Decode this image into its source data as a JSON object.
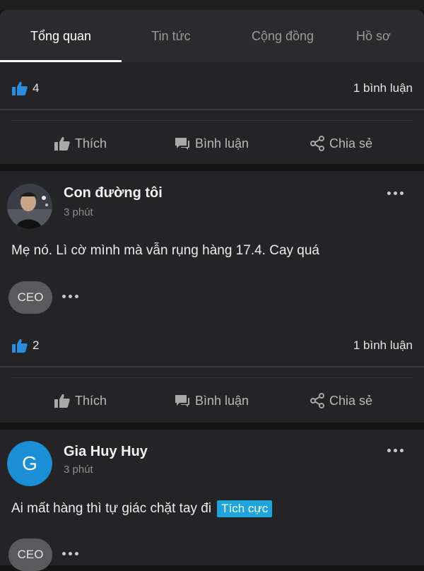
{
  "tabs": [
    "Tổng quan",
    "Tin tức",
    "Cộng đồng",
    "Hồ sơ"
  ],
  "actions": {
    "like": "Thích",
    "comment": "Bình luận",
    "share": "Chia sẻ"
  },
  "post_prev": {
    "likes": "4",
    "comments": "1 bình luận"
  },
  "post1": {
    "author": "Con đường tôi",
    "time": "3 phút",
    "content": "Mẹ nó. Lì cờ mình mà vẫn rụng hàng 17.4. Cay quá",
    "badge": "CEO",
    "likes": "2",
    "comments": "1 bình luận"
  },
  "post2": {
    "author": "Gia Huy Huy",
    "avatar_letter": "G",
    "avatar_color": "#1a8fd6",
    "time": "3 phút",
    "content": "Ai mất hàng thì tự giác chặt tay đi",
    "tag": "Tích cực",
    "badge": "CEO"
  },
  "colors": {
    "accent": "#1ea5dc",
    "like_icon": "#2a8ee0"
  }
}
